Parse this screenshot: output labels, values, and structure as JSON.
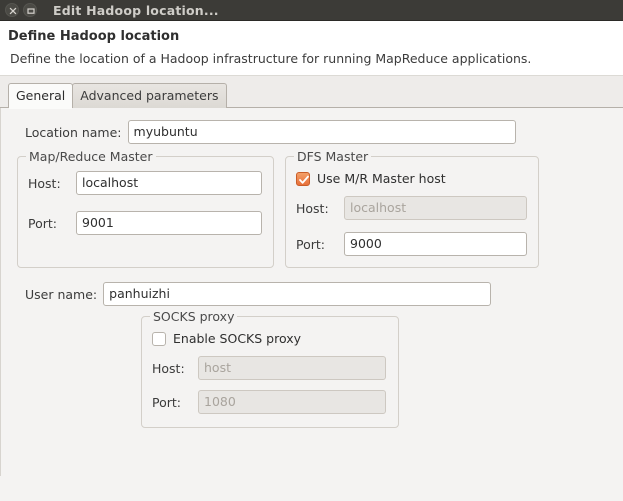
{
  "window": {
    "title": "Edit Hadoop location...",
    "close_icon": "close-icon",
    "maximize_icon": "maximize-icon"
  },
  "header": {
    "title": "Define Hadoop location",
    "description": "Define the location of a Hadoop infrastructure for running MapReduce applications."
  },
  "tabs": [
    {
      "label": "General",
      "active": true
    },
    {
      "label": "Advanced parameters",
      "active": false
    }
  ],
  "form": {
    "location_name": {
      "label": "Location name:",
      "value": "myubuntu"
    },
    "mapreduce_master": {
      "title": "Map/Reduce Master",
      "host_label": "Host:",
      "host_value": "localhost",
      "port_label": "Port:",
      "port_value": "9001"
    },
    "dfs_master": {
      "title": "DFS Master",
      "use_mr_host_label": "Use M/R Master host",
      "use_mr_host_checked": true,
      "host_label": "Host:",
      "host_value": "localhost",
      "host_disabled": true,
      "port_label": "Port:",
      "port_value": "9000"
    },
    "user_name": {
      "label": "User name:",
      "value": "panhuizhi"
    },
    "socks_proxy": {
      "title": "SOCKS proxy",
      "enable_label": "Enable SOCKS proxy",
      "enable_checked": false,
      "host_label": "Host:",
      "host_value": "host",
      "port_label": "Port:",
      "port_value": "1080"
    }
  },
  "colors": {
    "titlebar": "#3c3b37",
    "accent_checkbox": "#e8703a",
    "background": "#f4f3f2"
  }
}
